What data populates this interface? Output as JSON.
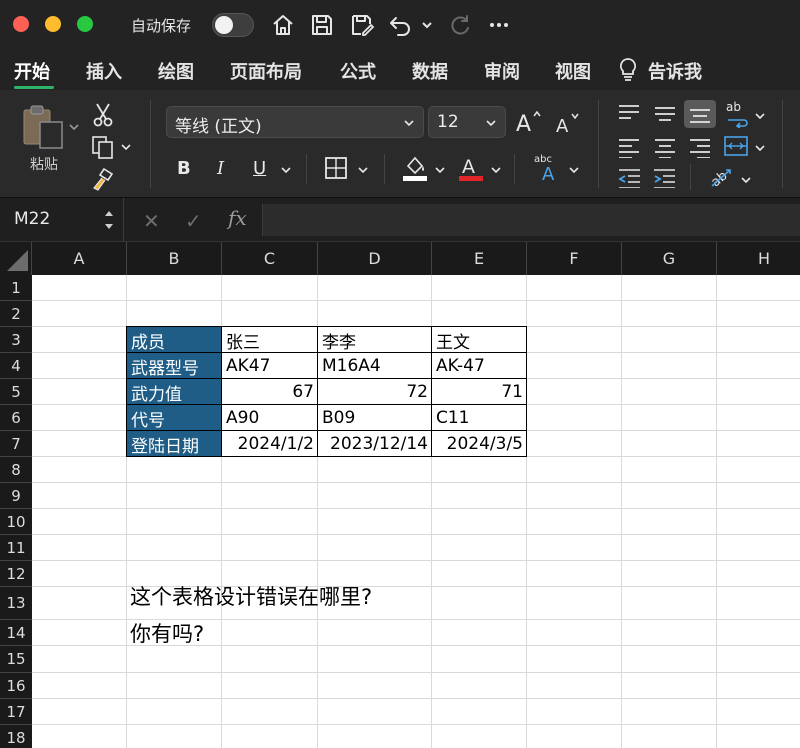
{
  "titlebar": {
    "autosave_label": "自动保存"
  },
  "tabs": [
    {
      "label": "开始",
      "active": true
    },
    {
      "label": "插入"
    },
    {
      "label": "绘图"
    },
    {
      "label": "页面布局"
    },
    {
      "label": "公式"
    },
    {
      "label": "数据"
    },
    {
      "label": "审阅"
    },
    {
      "label": "视图"
    },
    {
      "label": "告诉我"
    }
  ],
  "ribbon": {
    "paste_label": "粘贴",
    "font_name": "等线 (正文)",
    "font_size": "12",
    "bold": "B",
    "italic": "I",
    "underline": "U",
    "font_color": "#e0262b",
    "fill_color": "#ffffff"
  },
  "formula_bar": {
    "name_box": "M22",
    "cancel": "✕",
    "enter": "✓",
    "fx": "fx",
    "value": ""
  },
  "grid": {
    "columns": [
      "A",
      "B",
      "C",
      "D",
      "E",
      "F",
      "G",
      "H"
    ],
    "rows": [
      "1",
      "2",
      "3",
      "4",
      "5",
      "6",
      "7",
      "8",
      "9",
      "10",
      "11",
      "12",
      "13",
      "14",
      "15",
      "16",
      "17",
      "18"
    ],
    "table": [
      [
        "成员",
        "张三",
        "李李",
        "王文"
      ],
      [
        "武器型号",
        "AK47",
        "M16A4",
        "AK-47"
      ],
      [
        "武力值",
        "67",
        "72",
        "71"
      ],
      [
        "代号",
        "A90",
        "B09",
        "C11"
      ],
      [
        "登陆日期",
        "2024/1/2",
        "2023/12/14",
        "2024/3/5"
      ]
    ],
    "header_color": "#1f5c86",
    "note_line1": "这个表格设计错误在哪里?",
    "note_line2": "你有吗?"
  }
}
